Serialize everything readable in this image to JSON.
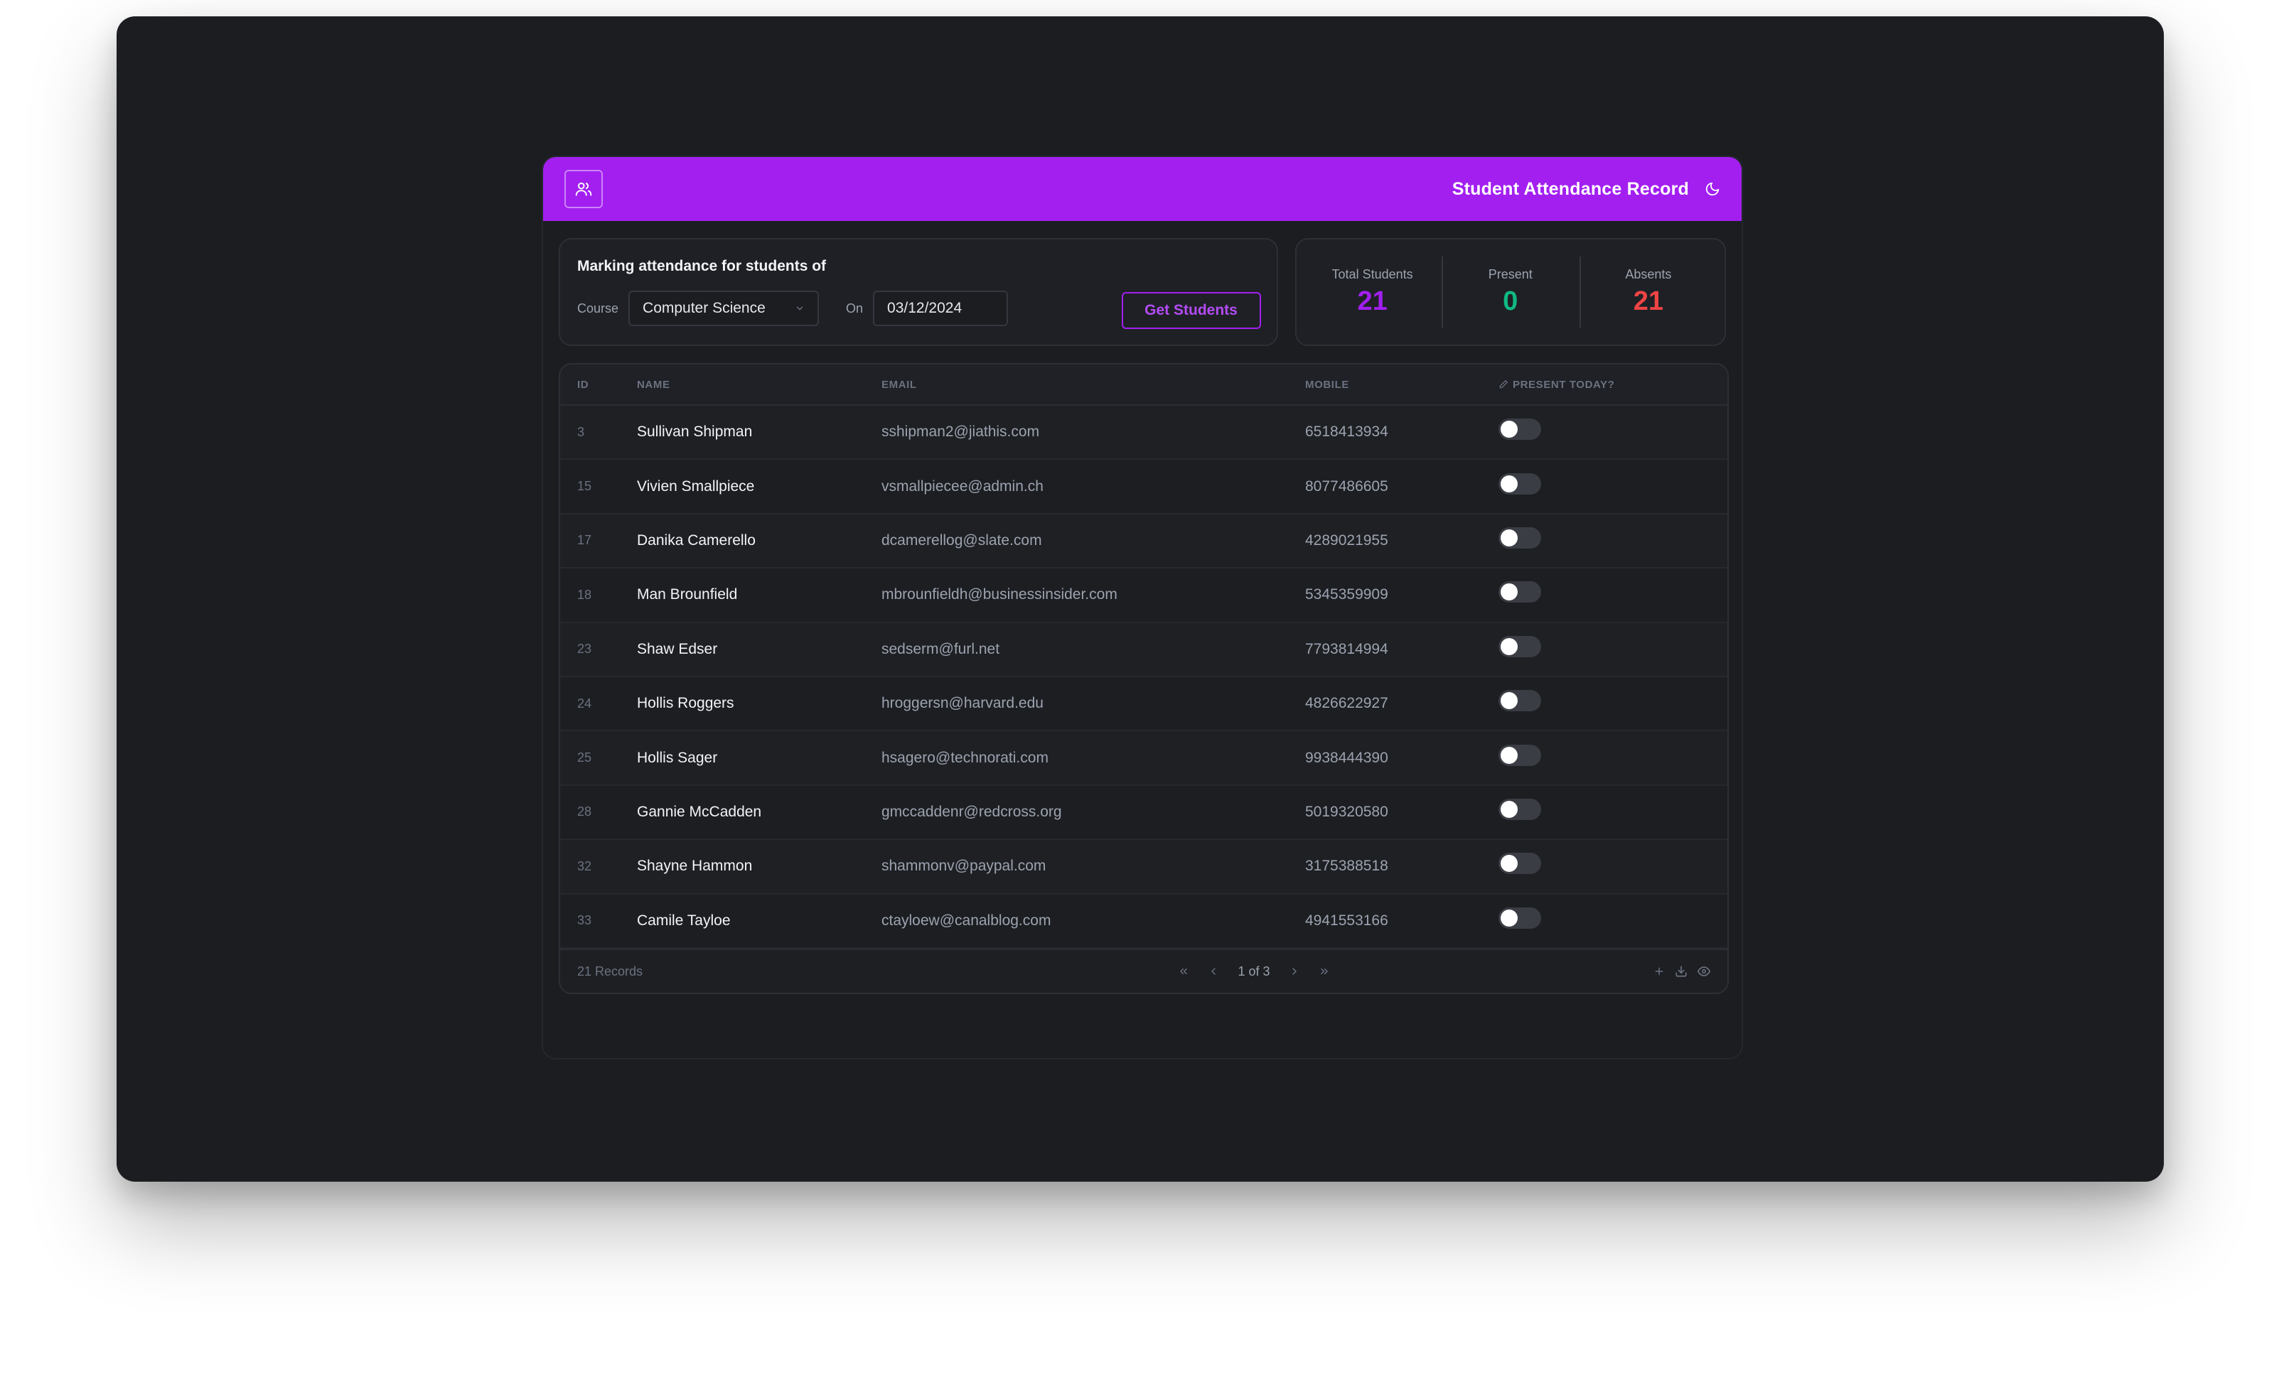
{
  "header": {
    "title": "Student Attendance Record",
    "logo_icon": "users-icon",
    "theme_icon": "moon-icon",
    "accent": "#a21ff0"
  },
  "form": {
    "title": "Marking attendance for students of",
    "course_label": "Course",
    "course_value": "Computer Science",
    "date_label": "On",
    "date_value": "03/12/2024",
    "submit_label": "Get Students"
  },
  "stats": [
    {
      "label": "Total Students",
      "value": "21",
      "color": "#a21ff0"
    },
    {
      "label": "Present",
      "value": "0",
      "color": "#10b981"
    },
    {
      "label": "Absents",
      "value": "21",
      "color": "#ef4444"
    }
  ],
  "table": {
    "columns": {
      "id": "ID",
      "name": "NAME",
      "email": "EMAIL",
      "mobile": "MOBILE",
      "present": "PRESENT TODAY?"
    },
    "rows": [
      {
        "id": "3",
        "name": "Sullivan Shipman",
        "email": "sshipman2@jiathis.com",
        "mobile": "6518413934",
        "present": false
      },
      {
        "id": "15",
        "name": "Vivien Smallpiece",
        "email": "vsmallpiecee@admin.ch",
        "mobile": "8077486605",
        "present": false
      },
      {
        "id": "17",
        "name": "Danika Camerello",
        "email": "dcamerellog@slate.com",
        "mobile": "4289021955",
        "present": false
      },
      {
        "id": "18",
        "name": "Man Brounfield",
        "email": "mbrounfieldh@businessinsider.com",
        "mobile": "5345359909",
        "present": false
      },
      {
        "id": "23",
        "name": "Shaw Edser",
        "email": "sedserm@furl.net",
        "mobile": "7793814994",
        "present": false
      },
      {
        "id": "24",
        "name": "Hollis Roggers",
        "email": "hroggersn@harvard.edu",
        "mobile": "4826622927",
        "present": false
      },
      {
        "id": "25",
        "name": "Hollis Sager",
        "email": "hsagero@technorati.com",
        "mobile": "9938444390",
        "present": false
      },
      {
        "id": "28",
        "name": "Gannie McCadden",
        "email": "gmccaddenr@redcross.org",
        "mobile": "5019320580",
        "present": false
      },
      {
        "id": "32",
        "name": "Shayne Hammon",
        "email": "shammonv@paypal.com",
        "mobile": "3175388518",
        "present": false
      },
      {
        "id": "33",
        "name": "Camile Tayloe",
        "email": "ctayloew@canalblog.com",
        "mobile": "4941553166",
        "present": false
      }
    ],
    "footer": {
      "records": "21 Records",
      "page_label": "1 of 3",
      "first_icon": "chevrons-left-icon",
      "prev_icon": "chevron-left-icon",
      "next_icon": "chevron-right-icon",
      "last_icon": "chevrons-right-icon",
      "tools": [
        "plus-icon",
        "download-icon",
        "eye-icon"
      ]
    }
  }
}
